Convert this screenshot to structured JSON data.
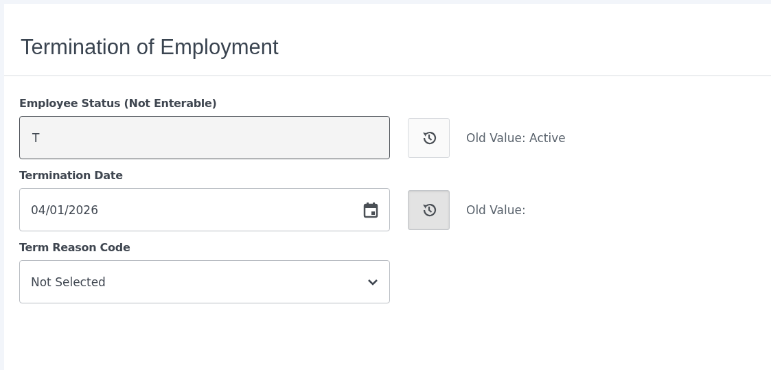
{
  "title": "Termination of Employment",
  "fields": [
    {
      "kind": "text",
      "label": "Employee Status (Not Enterable)",
      "value": "T",
      "disabled": true,
      "history": {
        "pressed": false,
        "old_value": "Old Value: Active"
      }
    },
    {
      "kind": "date",
      "label": "Termination Date",
      "value": "04/01/2026",
      "disabled": false,
      "history": {
        "pressed": true,
        "old_value": "Old Value:"
      }
    },
    {
      "kind": "select",
      "label": "Term Reason Code",
      "value": "Not Selected",
      "disabled": false
    }
  ]
}
